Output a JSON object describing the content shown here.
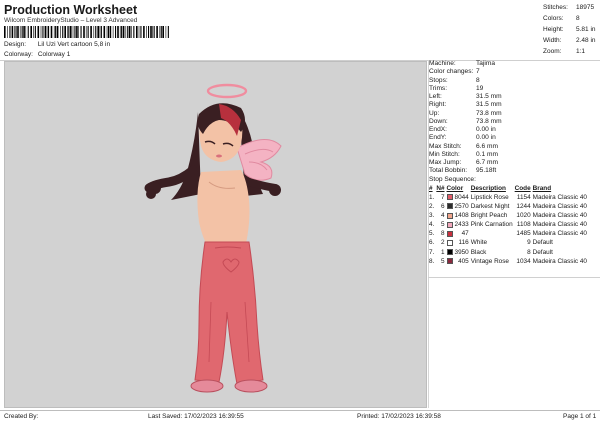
{
  "header": {
    "title": "Production Worksheet",
    "software": "Wilcom EmbroideryStudio – Level 3 Advanced",
    "design_label": "Design:",
    "design_value": "Lil Uzi Vert cartoon 5,8 in",
    "colorway_label": "Colorway:",
    "colorway_value": "Colorway 1"
  },
  "top_stats": [
    {
      "label": "Stitches:",
      "value": "18975"
    },
    {
      "label": "Colors:",
      "value": "8"
    },
    {
      "label": "Height:",
      "value": "5.81 in"
    },
    {
      "label": "Width:",
      "value": "2.48 in"
    },
    {
      "label": "Zoom:",
      "value": "1:1"
    }
  ],
  "machine_info": [
    {
      "label": "Machine:",
      "value": "Tajima"
    },
    {
      "label": "Color changes:",
      "value": "7"
    },
    {
      "label": "Stops:",
      "value": "8"
    },
    {
      "label": "Trims:",
      "value": "19"
    },
    {
      "label": "Left:",
      "value": "31.5 mm"
    },
    {
      "label": "Right:",
      "value": "31.5 mm"
    },
    {
      "label": "Up:",
      "value": "73.8 mm"
    },
    {
      "label": "Down:",
      "value": "73.8 mm"
    },
    {
      "label": "EndX:",
      "value": "0.00 in"
    },
    {
      "label": "EndY:",
      "value": "0.00 in"
    },
    {
      "label": "Max Stitch:",
      "value": "6.6 mm"
    },
    {
      "label": "Min Stitch:",
      "value": "0.1 mm"
    },
    {
      "label": "Max Jump:",
      "value": "6.7 mm"
    },
    {
      "label": "Total Bobbin:",
      "value": "95.18ft"
    }
  ],
  "stop_sequence": {
    "title": "Stop Sequence:",
    "headers": [
      "#",
      "N#",
      "Color",
      "Description",
      "Code",
      "Brand"
    ],
    "rows": [
      {
        "stop": "1.",
        "n": "7",
        "swatch": "#e05b68",
        "color": "8044",
        "description": "Lipstick Rose",
        "code": "1154",
        "brand": "Madeira Classic 40"
      },
      {
        "stop": "2.",
        "n": "6",
        "swatch": "#2b2b2b",
        "color": "2570",
        "description": "Darkest Night",
        "code": "1244",
        "brand": "Madeira Classic 40"
      },
      {
        "stop": "3.",
        "n": "4",
        "swatch": "#f0a58c",
        "color": "1408",
        "description": "Bright Peach",
        "code": "1020",
        "brand": "Madeira Classic 40"
      },
      {
        "stop": "4.",
        "n": "5",
        "swatch": "#f2a8bc",
        "color": "2433",
        "description": "Pink Carnation",
        "code": "1108",
        "brand": "Madeira Classic 40"
      },
      {
        "stop": "5.",
        "n": "8",
        "swatch": "#c9303e",
        "color": "47",
        "description": "",
        "code": "1485",
        "brand": "Madeira Classic 40"
      },
      {
        "stop": "6.",
        "n": "2",
        "swatch": "#ffffff",
        "color": "116",
        "description": "White",
        "code": "9",
        "brand": "Default"
      },
      {
        "stop": "7.",
        "n": "1",
        "swatch": "#000000",
        "color": "3950",
        "description": "Black",
        "code": "8",
        "brand": "Default"
      },
      {
        "stop": "8.",
        "n": "5",
        "swatch": "#8a2a3e",
        "color": "405",
        "description": "Vintage Rose",
        "code": "1034",
        "brand": "Madeira Classic 40"
      }
    ]
  },
  "footer": {
    "created_by": "Created By:",
    "last_saved": "Last Saved: 17/02/2023 16:39:55",
    "printed": "Printed: 17/02/2023 16:39:58",
    "page": "Page 1 of 1"
  },
  "colors": {
    "design_background": "#d2d2d2",
    "pants": "#e0686f",
    "skin": "#f3c2a6",
    "hair": "#3a1f22",
    "hair_red": "#b7303d",
    "wings": "#f4b3c3",
    "halo": "#f08d9f"
  }
}
